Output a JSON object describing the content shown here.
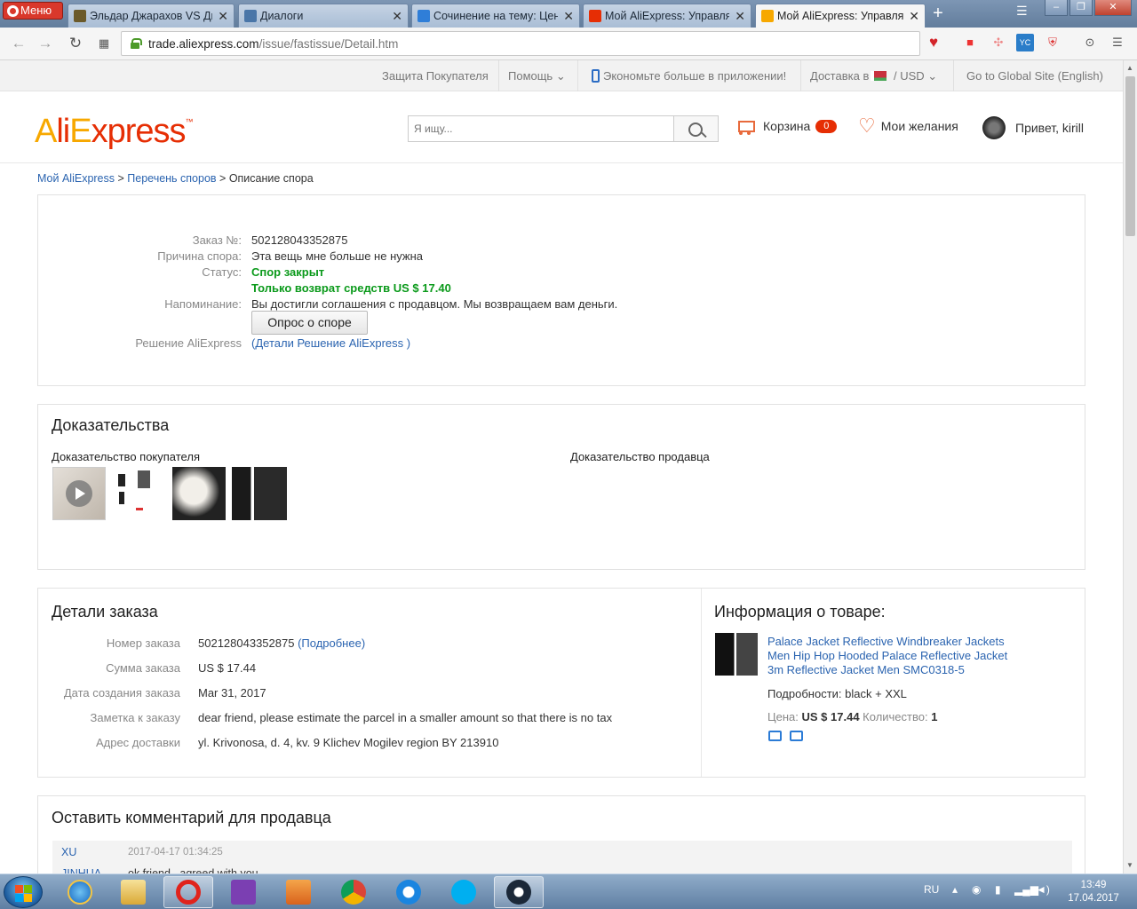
{
  "browser": {
    "menu_label": "Меню",
    "tabs": [
      {
        "title": "Эльдар Джарахов VS Дми",
        "icon_color": "#6b5a2a",
        "active": false
      },
      {
        "title": "Диалоги",
        "icon_color": "#4a76a8",
        "active": false
      },
      {
        "title": "Сочинение на тему: Цен",
        "icon_color": "#2f7ed8",
        "active": false
      },
      {
        "title": "Мой AliExpress: Управлят",
        "icon_color": "#e62e04",
        "active": false
      },
      {
        "title": "Мой AliExpress: Управлят",
        "icon_color": "#f7a800",
        "active": true
      }
    ],
    "new_tab": "+",
    "url_domain": "trade.aliexpress.com",
    "url_path": "/issue/fastissue/Detail.htm"
  },
  "topnav": {
    "buyer_protection": "Защита Покупателя",
    "help": "Помощь",
    "app_promo": "Экономьте больше в приложении!",
    "ship_to": "Доставка в",
    "currency": "USD",
    "global_site": "Go to Global Site (English)"
  },
  "header": {
    "logo": "AliExpress",
    "search_placeholder": "Я ищу...",
    "cart_label": "Корзина",
    "cart_count": "0",
    "wishlist_label": "Мои желания",
    "greeting": "Привет, kirill"
  },
  "breadcrumb": {
    "my_aliexpress": "Мой AliExpress",
    "sep1": " > ",
    "dispute_list": "Перечень споров",
    "sep2": " > ",
    "current": "Описание спора"
  },
  "dispute": {
    "order_label": "Заказ №:",
    "order_no": "502128043352875",
    "reason_label": "Причина спора:",
    "reason": "Эта вещь мне больше не нужна",
    "status_label": "Статус:",
    "status": "Спор закрыт",
    "refund": "Только возврат средств US $ 17.40",
    "reminder_label": "Напоминание:",
    "reminder": "Вы достигли соглашения с продавцом. Мы возвращаем вам деньги.",
    "survey_button": "Опрос о споре",
    "decision_label": "Решение AliExpress",
    "decision_open": "(",
    "decision_link": "Детали Решение AliExpress",
    "decision_close": " )"
  },
  "evidence": {
    "title": "Доказательства",
    "buyer_title": "Доказательство покупателя",
    "seller_title": "Доказательство продавца"
  },
  "order": {
    "title": "Детали заказа",
    "rows": [
      {
        "label": "Номер заказа",
        "value": "502128043352875"
      },
      {
        "label": "Сумма заказа",
        "value": "US $ 17.44"
      },
      {
        "label": "Дата создания заказа",
        "value": "Mar 31, 2017"
      },
      {
        "label": "Заметка к заказу",
        "value": "dear friend, please estimate the parcel in a smaller amount so that there is no tax"
      },
      {
        "label": "Адрес доставки",
        "value": "yl. Krivonosa, d. 4, kv. 9 Klichev Mogilev region BY 213910"
      }
    ],
    "more_link": "(Подробнее)"
  },
  "product": {
    "title": "Информация о товаре:",
    "name": "Palace Jacket Reflective Windbreaker Jackets Men Hip Hop Hooded Palace Reflective Jacket 3m Reflective Jacket Men SMC0318-5",
    "details_label": "Подробности:",
    "details": "black + XXL",
    "price_label": "Цена:",
    "price": "US $ 17.44",
    "qty_label": "Количество:",
    "qty": "1"
  },
  "comments": {
    "title": "Оставить комментарий для продавца",
    "first_author": "XU",
    "first_time": "2017-04-17 01:34:25",
    "second_author": "JINHUA",
    "second_text": "ok friend , agreed with you"
  },
  "taskbar": {
    "lang": "RU",
    "time": "13:49",
    "date": "17.04.2017"
  }
}
